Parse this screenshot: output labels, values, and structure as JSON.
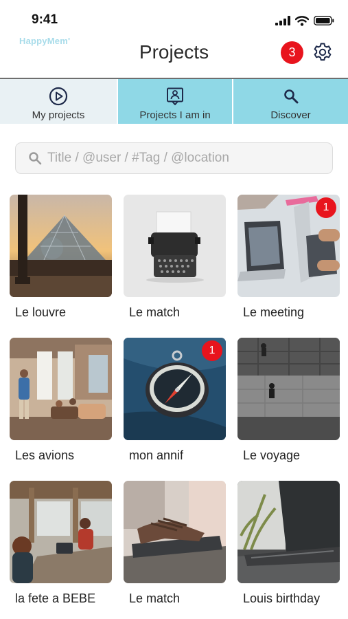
{
  "status_bar": {
    "time": "9:41"
  },
  "header": {
    "brand": "HappyMem'",
    "title": "Projects",
    "notification_count": "3"
  },
  "tabs": [
    {
      "label": "My projects",
      "icon": "play-circle-icon",
      "active": true
    },
    {
      "label": "Projects I am in",
      "icon": "person-board-icon",
      "active": false
    },
    {
      "label": "Discover",
      "icon": "search-icon",
      "active": false
    }
  ],
  "search": {
    "placeholder": "Title / @user / #Tag / @location"
  },
  "projects": [
    {
      "title": "Le louvre",
      "badge": ""
    },
    {
      "title": "Le match",
      "badge": ""
    },
    {
      "title": "Le meeting",
      "badge": "1"
    },
    {
      "title": "Les avions",
      "badge": ""
    },
    {
      "title": "mon annif",
      "badge": "1"
    },
    {
      "title": "Le voyage",
      "badge": ""
    },
    {
      "title": "la fete a BEBE",
      "badge": ""
    },
    {
      "title": "Le match",
      "badge": ""
    },
    {
      "title": "Louis birthday",
      "badge": ""
    }
  ],
  "colors": {
    "tab_bg": "#8fd8e6",
    "tab_active_bg": "#e9f1f4",
    "badge": "#e8141d",
    "brand": "#a8dcea"
  }
}
